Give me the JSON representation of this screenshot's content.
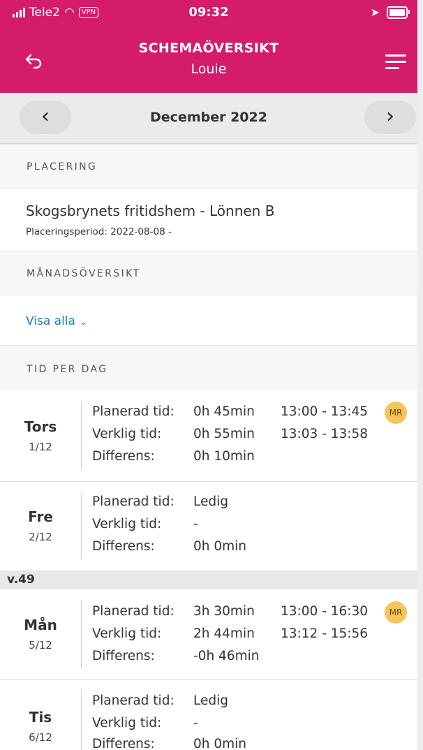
{
  "status_bar": {
    "carrier": "Tele2",
    "vpn": "VPN",
    "time": "09:32"
  },
  "header": {
    "title": "SCHEMAÖVERSIKT",
    "subtitle": "Louie",
    "back_icon": "back-arrow-icon",
    "menu_icon": "hamburger-menu-icon"
  },
  "month_nav": {
    "prev": "‹",
    "next": "›",
    "label": "December 2022"
  },
  "placement": {
    "section_title": "PLACERING",
    "name": "Skogsbrynets fritidshem - Lönnen B",
    "period": "Placeringsperiod: 2022-08-08 -"
  },
  "month_overview": {
    "section_title": "MÅNADSÖVERSIKT",
    "show_all": "Visa alla",
    "chevron": "⌄"
  },
  "per_day": {
    "section_title": "TID PER DAG",
    "labels": {
      "planned": "Planerad tid:",
      "actual": "Verklig tid:",
      "diff": "Differens:"
    },
    "week_label": "v.49",
    "days": [
      {
        "name": "Tors",
        "date": "1/12",
        "planned": "0h 45min",
        "planned_range": "13:00 - 13:45",
        "actual": "0h 55min",
        "actual_range": "13:03 - 13:58",
        "diff": "0h 10min",
        "badge": "MR"
      },
      {
        "name": "Fre",
        "date": "2/12",
        "planned": "Ledig",
        "planned_range": "",
        "actual": "-",
        "actual_range": "",
        "diff": "0h 0min",
        "badge": ""
      },
      {
        "name": "Mån",
        "date": "5/12",
        "planned": "3h 30min",
        "planned_range": "13:00 - 16:30",
        "actual": "2h 44min",
        "actual_range": "13:12 - 15:56",
        "diff": "-0h 46min",
        "badge": "MR"
      },
      {
        "name": "Tis",
        "date": "6/12",
        "planned": "Ledig",
        "planned_range": "",
        "actual": "-",
        "actual_range": "",
        "diff": "0h 0min",
        "badge": ""
      }
    ]
  },
  "colors": {
    "header": "#d41c6b",
    "link": "#1f7bc1",
    "badge": "#f7c55e"
  }
}
